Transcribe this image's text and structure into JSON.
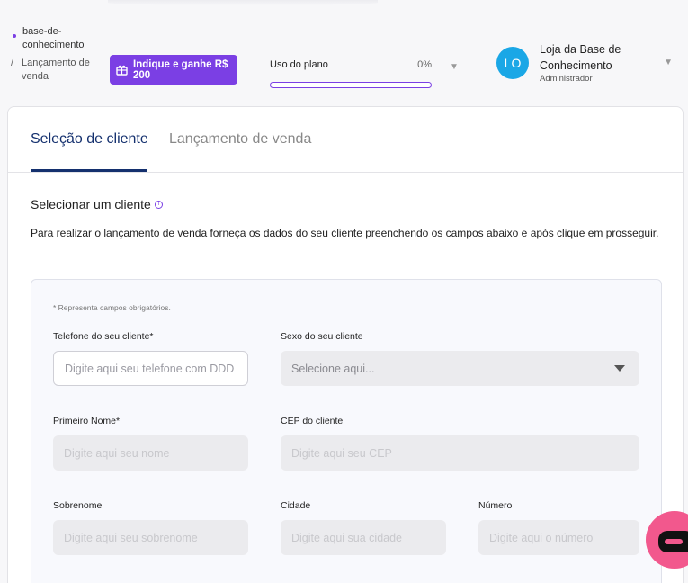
{
  "breadcrumb": {
    "items": [
      {
        "label": "base-de-conhecimento"
      },
      {
        "separator": "/",
        "label": "Lançamento de venda"
      }
    ]
  },
  "promo": {
    "label": "Indique e ganhe R$ 200",
    "icon": "gift-icon"
  },
  "plan_usage": {
    "label": "Uso do plano",
    "percent_text": "0%",
    "progress": 0
  },
  "user": {
    "initials": "LO",
    "name": "Loja da Base de Conhecimento",
    "role": "Administrador"
  },
  "tabs": [
    {
      "label": "Seleção de cliente",
      "active": true
    },
    {
      "label": "Lançamento de venda",
      "active": false
    }
  ],
  "section": {
    "title": "Selecionar um cliente",
    "description": "Para realizar o lançamento de venda forneça os dados do seu cliente preenchendo os campos abaixo e após clique em prosseguir."
  },
  "form": {
    "required_note": "* Representa campos obrigatórios.",
    "phone": {
      "label": "Telefone do seu cliente*",
      "placeholder": "Digite aqui seu telefone com DDD"
    },
    "gender": {
      "label": "Sexo do seu cliente",
      "placeholder": "Selecione aqui..."
    },
    "first_name": {
      "label": "Primeiro Nome*",
      "placeholder": "Digite aqui seu nome"
    },
    "cep": {
      "label": "CEP do cliente",
      "placeholder": "Digite aqui seu CEP"
    },
    "last_name": {
      "label": "Sobrenome",
      "placeholder": "Digite aqui seu sobrenome"
    },
    "city": {
      "label": "Cidade",
      "placeholder": "Digite aqui sua cidade"
    },
    "number": {
      "label": "Número",
      "placeholder": "Digite aqui o número"
    }
  },
  "colors": {
    "accent": "#7b3fe4",
    "primary": "#14306e",
    "avatar": "#1aa7e6",
    "chat": "#f2588d"
  },
  "chat": {
    "icon": "chat-icon"
  }
}
